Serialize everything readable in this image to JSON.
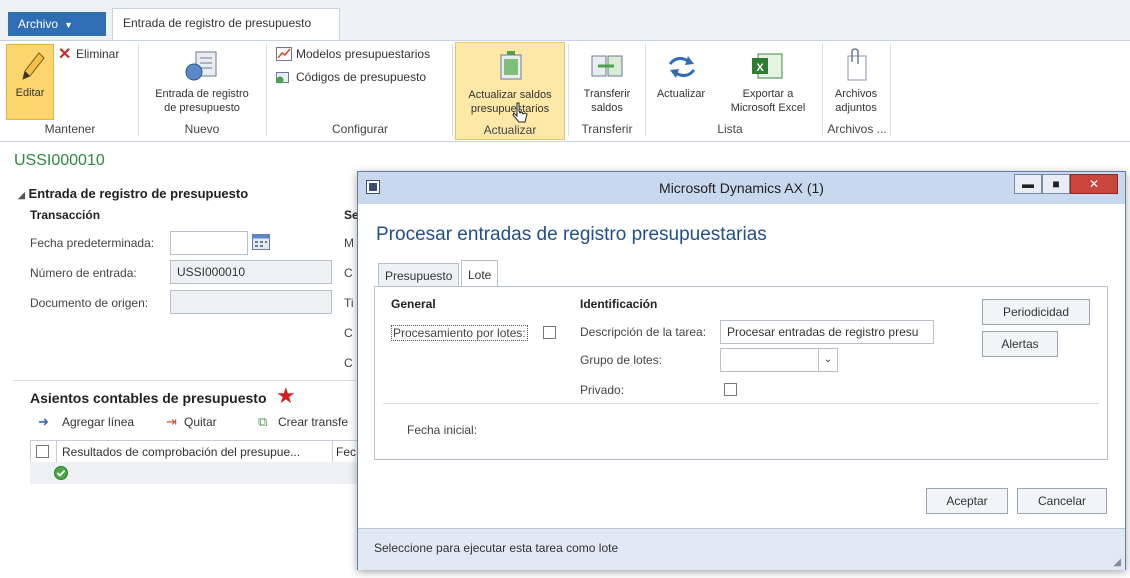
{
  "ribbon": {
    "file_tab": "Archivo",
    "active_tab": "Entrada de registro de presupuesto",
    "groups": {
      "mantener": {
        "label": "Mantener",
        "edit": "Editar",
        "delete": "Eliminar"
      },
      "nuevo": {
        "label": "Nuevo",
        "entry_line1": "Entrada de registro",
        "entry_line2": "de presupuesto"
      },
      "configurar": {
        "label": "Configurar",
        "models": "Modelos presupuestarios",
        "codes": "Códigos de presupuesto"
      },
      "actualizar": {
        "label": "Actualizar",
        "update_line1": "Actualizar saldos",
        "update_line2": "presupuestarios"
      },
      "transferir": {
        "label": "Transferir",
        "transfer_line1": "Transferir",
        "transfer_line2": "saldos"
      },
      "lista": {
        "label": "Lista",
        "refresh": "Actualizar",
        "export_line1": "Exportar a",
        "export_line2": "Microsoft Excel"
      },
      "archivos": {
        "label": "Archivos ...",
        "attach_line1": "Archivos",
        "attach_line2": "adjuntos"
      }
    }
  },
  "page": {
    "record_id": "USSI000010",
    "section_title": "Entrada de registro de presupuesto",
    "transaction": {
      "title": "Transacción",
      "default_date_label": "Fecha predeterminada:",
      "default_date_value": "",
      "entry_number_label": "Número de entrada:",
      "entry_number_value": "USSI000010",
      "source_doc_label": "Documento de origen:",
      "source_doc_value": ""
    },
    "second_column_title": "Se",
    "second_column_letters": [
      "M",
      "C",
      "Ti",
      "C",
      "C"
    ],
    "journal": {
      "title": "Asientos contables de presupuesto",
      "add_line": "Agregar línea",
      "remove": "Quitar",
      "create_transfer": "Crear transfe",
      "col_results": "Resultados de comprobación del presupue...",
      "col_date": "Fec"
    }
  },
  "dialog": {
    "window_title": "Microsoft Dynamics AX (1)",
    "heading": "Procesar entradas de registro presupuestarias",
    "tabs": [
      "Presupuesto",
      "Lote"
    ],
    "general_title": "General",
    "batch_processing_label": "Procesamiento por lotes:",
    "identification_title": "Identificación",
    "task_desc_label": "Descripción de la tarea:",
    "task_desc_value": "Procesar entradas de registro presu",
    "batch_group_label": "Grupo de lotes:",
    "batch_group_value": "",
    "private_label": "Privado:",
    "start_date_label": "Fecha inicial:",
    "recurrence_button": "Periodicidad",
    "alerts_button": "Alertas",
    "ok_button": "Aceptar",
    "cancel_button": "Cancelar",
    "status_text": "Seleccione para ejecutar esta tarea como lote"
  },
  "colors": {
    "accent": "#2f6db5",
    "record_id": "#2b8a3e",
    "highlight": "#fbd56e",
    "required_star": "#d32020"
  }
}
